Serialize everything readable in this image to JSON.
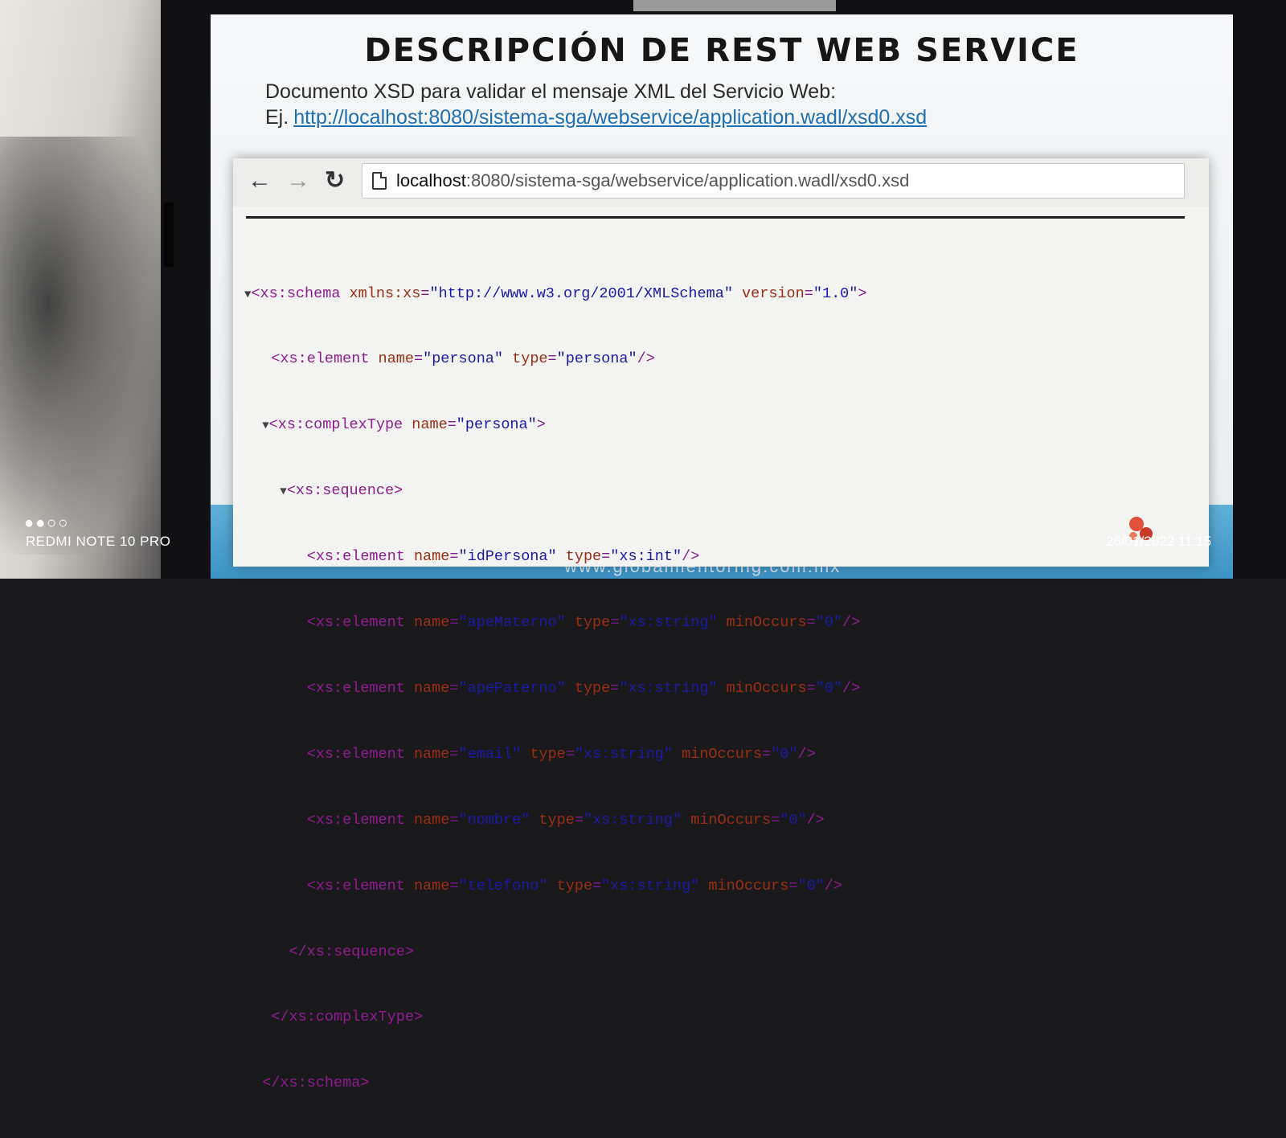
{
  "slide": {
    "title": "DESCRIPCIÓN DE REST WEB SERVICE",
    "description": "Documento XSD para validar el mensaje XML del Servicio Web:",
    "example_prefix": "Ej.",
    "example_link": "http://localhost:8080/sistema-sga/webservice/application.wadl/xsd0.xsd",
    "footer_url": "www.globalmentoring.com.mx"
  },
  "browser": {
    "url_host": "localhost",
    "url_rest": ":8080/sistema-sga/webservice/application.wadl/xsd0.xsd",
    "icons": [
      "back-arrow-icon",
      "forward-arrow-icon",
      "reload-icon",
      "page-icon"
    ]
  },
  "xml": {
    "ns_attr": "xmlns:xs",
    "ns_value": "\"http://www.w3.org/2001/XMLSchema\"",
    "version_attr": "version",
    "version_value": "\"1.0\"",
    "root_name": "persona",
    "fields": [
      {
        "name": "idPersona",
        "type": "xs:int",
        "minOccurs": ""
      },
      {
        "name": "apeMaterno",
        "type": "xs:string",
        "minOccurs": "0"
      },
      {
        "name": "apePaterno",
        "type": "xs:string",
        "minOccurs": "0"
      },
      {
        "name": "email",
        "type": "xs:string",
        "minOccurs": "0"
      },
      {
        "name": "nombre",
        "type": "xs:string",
        "minOccurs": "0"
      },
      {
        "name": "telefono",
        "type": "xs:string",
        "minOccurs": "0"
      }
    ]
  },
  "overlay": {
    "dots": "●●○○",
    "device": "REDMI NOTE 10 PRO",
    "timestamp": "26/01/2022 11:15"
  },
  "colors": {
    "title": "#161616",
    "link": "#1f6fb1",
    "xml_tag": "#8e1b8f",
    "xml_attr": "#9a2d12",
    "xml_value": "#1a1aa6",
    "footer": "#3d93c6"
  }
}
